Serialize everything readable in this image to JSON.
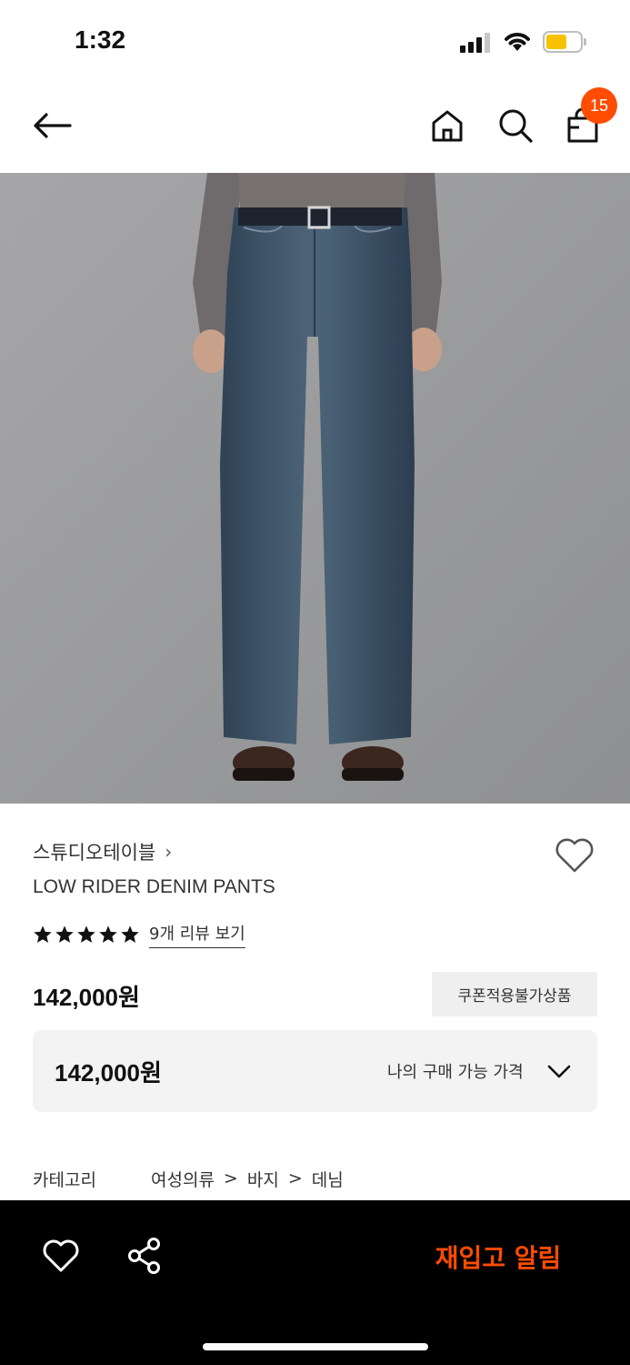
{
  "status": {
    "time": "1:32",
    "battery_color": "#f7c300"
  },
  "header": {
    "back_icon": "arrow-left-icon",
    "home_icon": "home-icon",
    "search_icon": "search-icon",
    "cart_icon": "shopping-bag-icon",
    "cart_count": "15",
    "badge_color": "#ff4c00"
  },
  "product": {
    "image": "denim-pants-photo",
    "brand": "스튜디오테이블",
    "brand_chevron": "›",
    "name": "LOW RIDER DENIM PANTS",
    "rating_stars": 5,
    "review_link": "9개 리뷰 보기",
    "price": "142,000원",
    "coupon_badge": "쿠폰적용불가상품",
    "my_price_value": "142,000원",
    "my_price_label": "나의 구매 가능 가격"
  },
  "category": {
    "label": "카테고리",
    "path": [
      "여성의류",
      "바지",
      "데님"
    ],
    "separator": ">"
  },
  "bottom_bar": {
    "wishlist_icon": "heart-icon",
    "share_icon": "share-icon",
    "restock_label": "재입고 알림",
    "accent": "#ff4c00"
  }
}
